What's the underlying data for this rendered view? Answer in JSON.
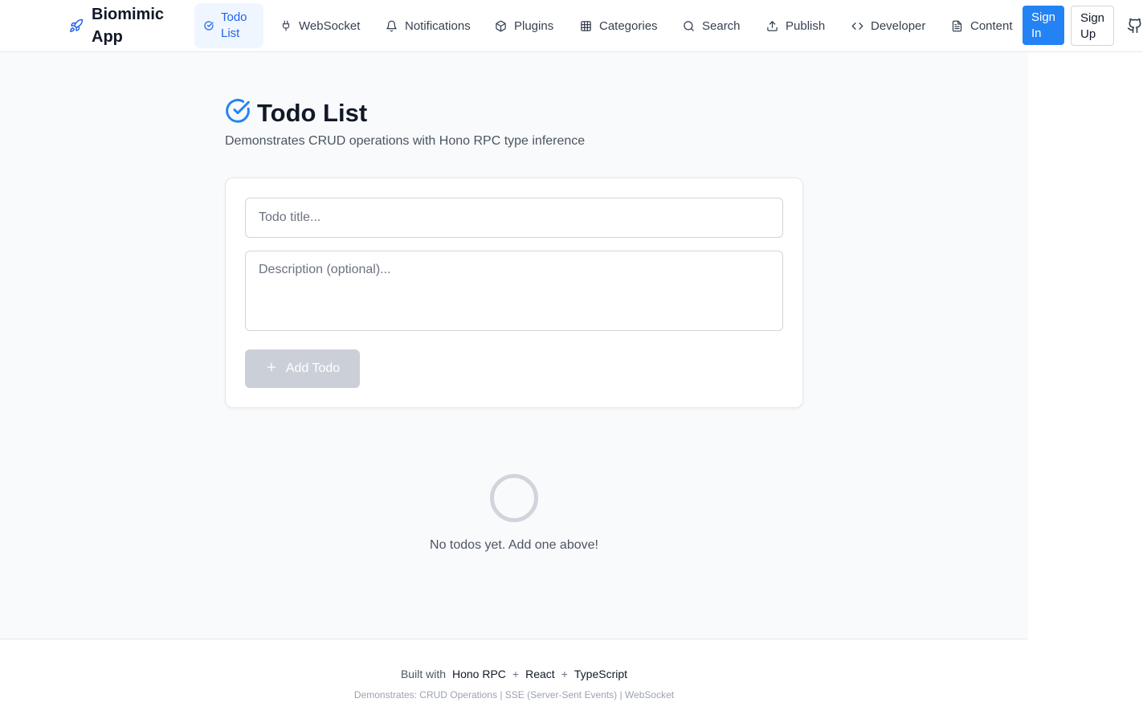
{
  "brand": {
    "name": "Biomimic App"
  },
  "nav": [
    {
      "label": "Todo List",
      "icon": "check-circle-icon",
      "active": true
    },
    {
      "label": "WebSocket",
      "icon": "plug-icon"
    },
    {
      "label": "Notifications",
      "icon": "bell-icon"
    },
    {
      "label": "Plugins",
      "icon": "package-icon"
    },
    {
      "label": "Categories",
      "icon": "grid-icon"
    },
    {
      "label": "Search",
      "icon": "search-icon"
    },
    {
      "label": "Publish",
      "icon": "upload-icon"
    },
    {
      "label": "Developer",
      "icon": "code-icon"
    },
    {
      "label": "Content",
      "icon": "file-text-icon"
    }
  ],
  "auth": {
    "sign_in": "Sign In",
    "sign_up": "Sign Up"
  },
  "page": {
    "title": "Todo List",
    "subtitle": "Demonstrates CRUD operations with Hono RPC type inference"
  },
  "form": {
    "title_placeholder": "Todo title...",
    "title_value": "",
    "description_placeholder": "Description (optional)...",
    "description_value": "",
    "add_label": "Add Todo"
  },
  "empty_state": {
    "text": "No todos yet. Add one above!"
  },
  "footer": {
    "built_with": "Built with",
    "techs": [
      "Hono RPC",
      "React",
      "TypeScript"
    ],
    "separator": "+",
    "demo_line": "Demonstrates: CRUD Operations | SSE (Server-Sent Events) | WebSocket"
  },
  "colors": {
    "accent": "#2383f5",
    "active_nav_bg": "#eff6ff",
    "disabled_button": "#cbd0d8",
    "page_bg": "#f9fafb"
  }
}
